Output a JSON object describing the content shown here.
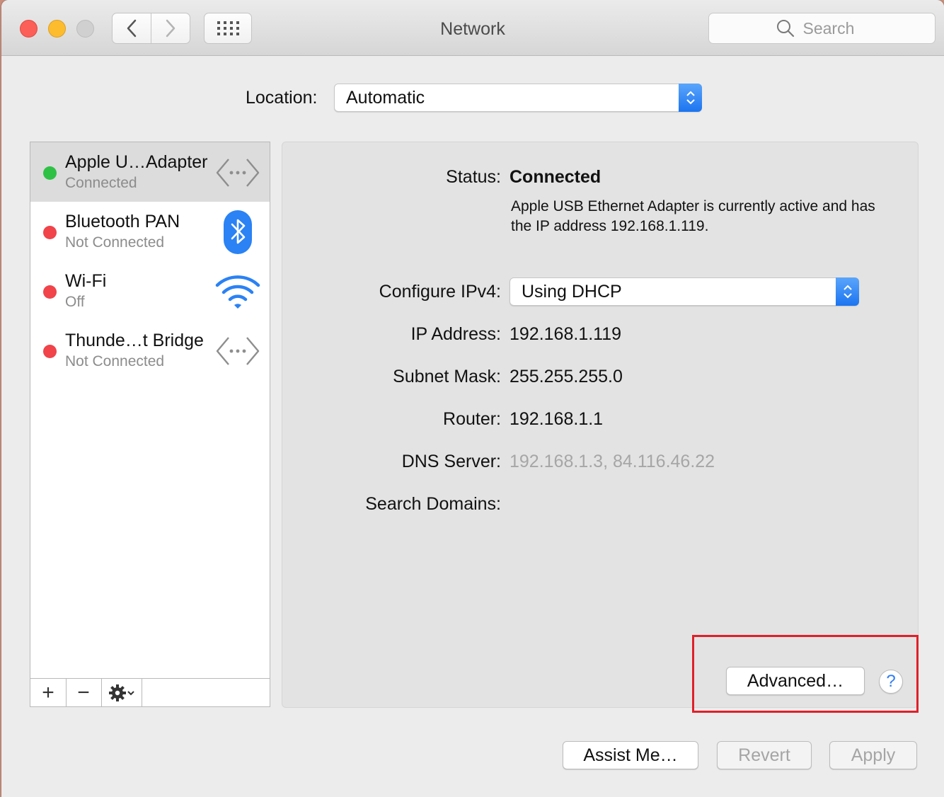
{
  "window": {
    "title": "Network",
    "search_placeholder": "Search"
  },
  "location": {
    "label": "Location:",
    "value": "Automatic"
  },
  "services": [
    {
      "name": "Apple U…Adapter",
      "status": "Connected",
      "dot_color": "#2fc146",
      "icon": "ethernet-icon",
      "selected": true
    },
    {
      "name": "Bluetooth PAN",
      "status": "Not Connected",
      "dot_color": "#f0434a",
      "icon": "bluetooth-icon",
      "selected": false
    },
    {
      "name": "Wi-Fi",
      "status": "Off",
      "dot_color": "#f0434a",
      "icon": "wifi-icon",
      "selected": false
    },
    {
      "name": "Thunde…t Bridge",
      "status": "Not Connected",
      "dot_color": "#f0434a",
      "icon": "ethernet-icon",
      "selected": false
    }
  ],
  "sidebar_toolbar": {
    "add": "+",
    "remove": "−"
  },
  "details": {
    "status_label": "Status:",
    "status_value": "Connected",
    "status_description": "Apple USB Ethernet Adapter is currently active and has the IP address 192.168.1.119.",
    "configure_label": "Configure IPv4:",
    "configure_value": "Using DHCP",
    "ip_label": "IP Address:",
    "ip_value": "192.168.1.119",
    "subnet_label": "Subnet Mask:",
    "subnet_value": "255.255.255.0",
    "router_label": "Router:",
    "router_value": "192.168.1.1",
    "dns_label": "DNS Server:",
    "dns_value": "192.168.1.3, 84.116.46.22",
    "search_domains_label": "Search Domains:",
    "advanced_button": "Advanced…",
    "help_button": "?"
  },
  "footer": {
    "assist_button": "Assist Me…",
    "revert_button": "Revert",
    "apply_button": "Apply"
  },
  "colors": {
    "accent": "#1c74f0",
    "highlight": "#e0202a",
    "dns_text": "#a6a6a6"
  }
}
